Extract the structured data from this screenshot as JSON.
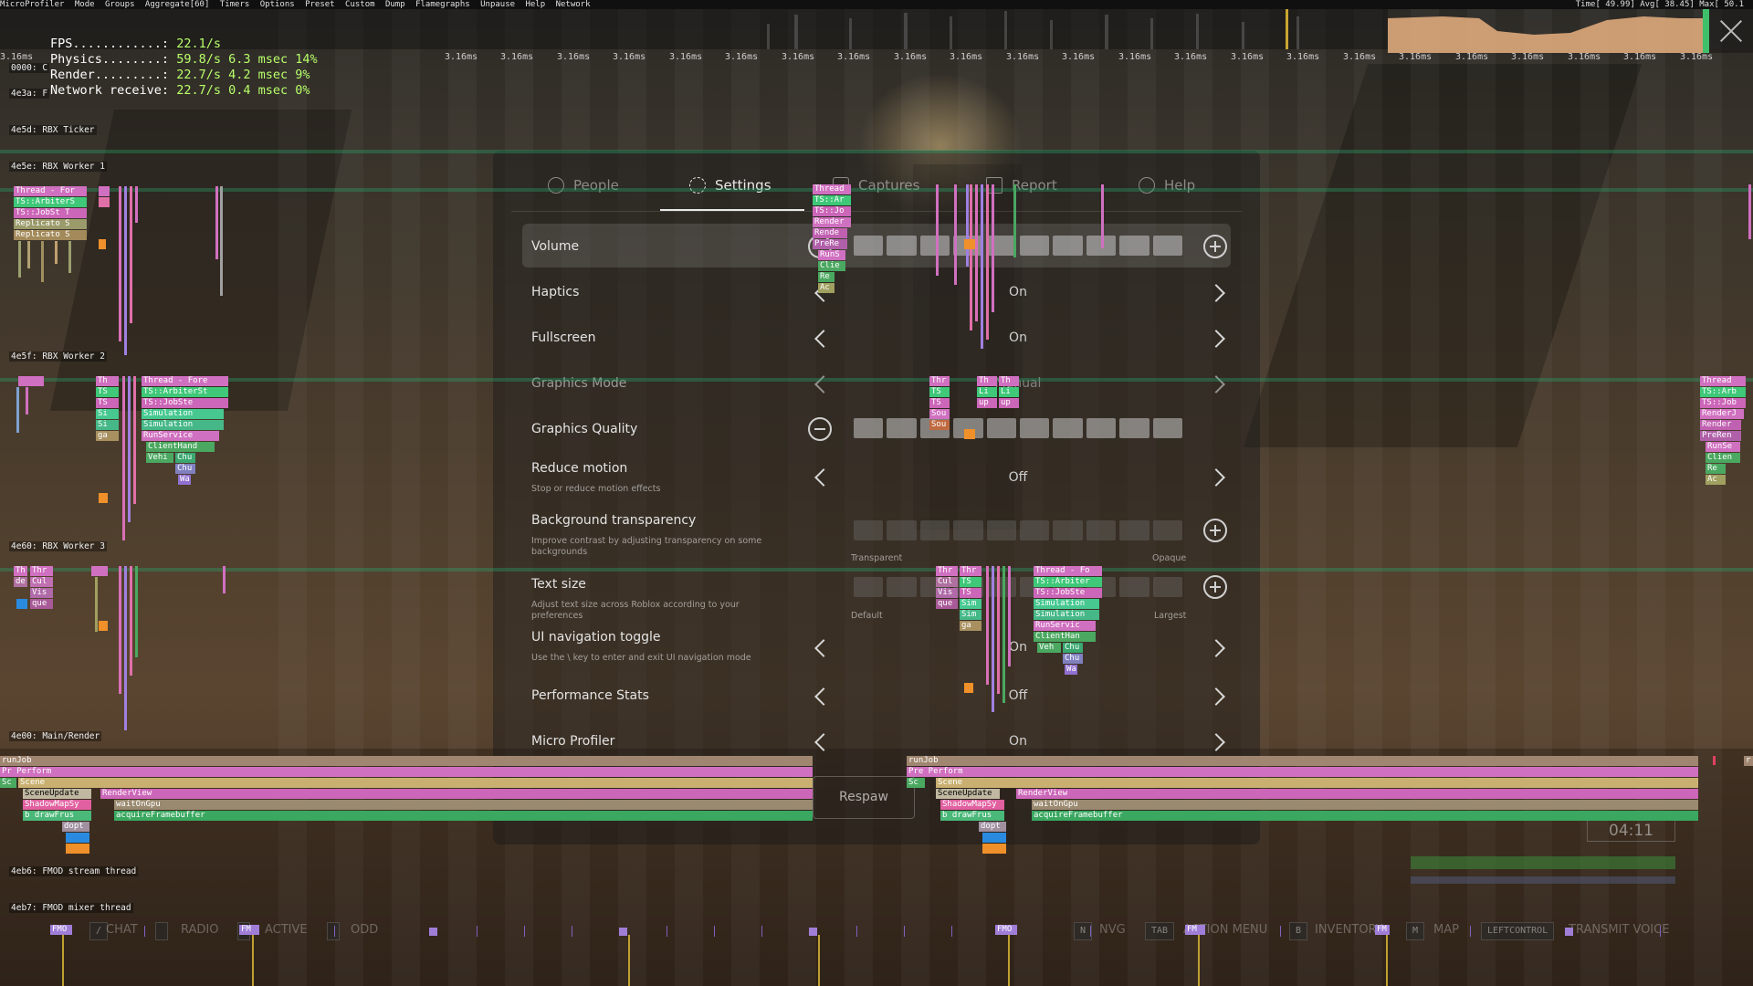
{
  "microprofiler": {
    "menu": [
      "MicroProfiler",
      "Mode",
      "Groups",
      "Aggregate[60]",
      "Timers",
      "Options",
      "Preset",
      "Custom",
      "Dump",
      "Flamegraphs",
      "Unpause",
      "Help",
      "Network"
    ],
    "stats": "Time[ 49.99] Avg[ 38.45] Max[ 50.1",
    "time_label": "3.16ms",
    "fps": {
      "label": "FPS............:",
      "value": "22.1/s"
    },
    "physics": {
      "label": "Physics........:",
      "value": "59.8/s 6.3 msec 14%"
    },
    "render": {
      "label": "Render.........:",
      "value": "22.7/s 4.2 msec 9%"
    },
    "network": {
      "label": "Network receive:",
      "value": "22.7/s 0.4 msec 0%"
    },
    "threads": {
      "t0000": "0000: C",
      "t4e3a": "4e3a: F",
      "ticker": "4e5d: RBX Ticker",
      "worker1": "4e5e: RBX Worker 1",
      "worker2": "4e5f: RBX Worker 2",
      "worker3": "4e60: RBX Worker 3",
      "main": "4e00: Main/Render",
      "fmod_stream": "4eb6: FMOD stream thread",
      "fmod_mixer": "4eb7: FMOD mixer thread"
    },
    "blocks": {
      "thread_for": "Thread - For",
      "ts_arbiter": "TS::ArbiterS",
      "ts_jobste": "TS::JobSt T",
      "replicato": "Replicato S",
      "thread_fore": "Thread - Fore",
      "ts_arbiterst": "TS::ArbiterSt",
      "ts_jobste2": "TS::JobSte",
      "simulation": "Simulation",
      "runservice": "RunService",
      "clienthand": "ClientHand",
      "vehi": "Vehi",
      "chu": "Chu",
      "wa": "Wa",
      "th": "Th",
      "ts": "TS",
      "si": "Si",
      "ga": "ga",
      "thread": "Thread",
      "ts_ar": "TS::Ar",
      "ts_jo": "TS::Jo",
      "render": "Render",
      "rende": "Rende",
      "prere": "PreRe",
      "runs": "RunS",
      "clie": "Clie",
      "re": "Re",
      "ac": "Ac",
      "thr": "Thr",
      "sou": "Sou",
      "li": "Li",
      "up": "up",
      "vis": "Vis",
      "que": "que",
      "cul": "Cul",
      "de": "de",
      "sim": "Sim",
      "thread_fo": "Thread - Fo",
      "ts_arbiter2": "TS::Arbiter",
      "ts_jobste3": "TS::JobSte",
      "runservic": "RunServic",
      "clienthan": "ClientHan",
      "veh": "Veh",
      "runjob": "runJob",
      "pre_perform": "Pre Perform",
      "pr_perform": "Pr Perform",
      "sc": "Sc",
      "scene": "Scene",
      "sceneupdate": "SceneUpdate",
      "renderview": "RenderView",
      "shadowmapsy": "ShadowMapSy",
      "waitongpu": "waitOnGpu",
      "b_drawfrus": "b  drawFrus",
      "acquireframebuffer": "acquireFramebuffer",
      "dopt": "dopt",
      "fmo": "FMO",
      "fm": "FM",
      "r": "r",
      "thread_r": "Thread",
      "ts_arb": "TS::Arb",
      "ts_job": "TS::Job",
      "renderj": "RenderJ",
      "preren": "PreRen",
      "runse": "RunSe",
      "clien": "Clien"
    }
  },
  "menu": {
    "tabs": [
      {
        "label": "People",
        "icon": "people-icon"
      },
      {
        "label": "Settings",
        "icon": "gear-icon"
      },
      {
        "label": "Captures",
        "icon": "camera-icon"
      },
      {
        "label": "Report",
        "icon": "flag-icon"
      },
      {
        "label": "Help",
        "icon": "help-icon"
      }
    ],
    "active_tab": "Settings",
    "rows": {
      "volume": {
        "label": "Volume"
      },
      "haptics": {
        "label": "Haptics",
        "value": "On"
      },
      "fullscreen": {
        "label": "Fullscreen",
        "value": "On"
      },
      "graphics_mode": {
        "label": "Graphics Mode",
        "value": "Manual"
      },
      "graphics_quality": {
        "label": "Graphics Quality"
      },
      "reduce_motion": {
        "label": "Reduce motion",
        "desc": "Stop or reduce motion effects",
        "value": "Off"
      },
      "bg_transparency": {
        "label": "Background transparency",
        "desc": "Improve contrast by adjusting transparency on some backgrounds",
        "min": "Transparent",
        "max": "Opaque"
      },
      "text_size": {
        "label": "Text size",
        "desc": "Adjust text size across Roblox according to your preferences",
        "min": "Default",
        "max": "Largest"
      },
      "ui_nav": {
        "label": "UI navigation toggle",
        "desc": "Use the \\ key to enter and exit UI navigation mode",
        "value": "On"
      },
      "perf_stats": {
        "label": "Performance Stats",
        "value": "Off"
      },
      "micro_profiler": {
        "label": "Micro Profiler",
        "value": "On"
      }
    },
    "respawn_label": "Respaw"
  },
  "hud": {
    "timer": "04:11",
    "keys": [
      {
        "key": "/",
        "label": "CHAT"
      },
      {
        "key": "",
        "label": "RADIO"
      },
      {
        "key": "",
        "label": "ACTIVE"
      },
      {
        "key": "",
        "label": "ODD"
      },
      {
        "key": "N",
        "label": "NVG"
      },
      {
        "key": "TAB",
        "label": "ACTION MENU"
      },
      {
        "key": "B",
        "label": "INVENTORY"
      },
      {
        "key": "M",
        "label": "MAP"
      },
      {
        "key": "LEFTCONTROL",
        "label": "TRANSMIT VOICE"
      }
    ]
  },
  "colors": {
    "accent_green": "#b8ff6a",
    "block_pink": "#e070c0",
    "block_green": "#4fd080",
    "block_orange": "#f0902a",
    "block_purple": "#a080e0"
  }
}
